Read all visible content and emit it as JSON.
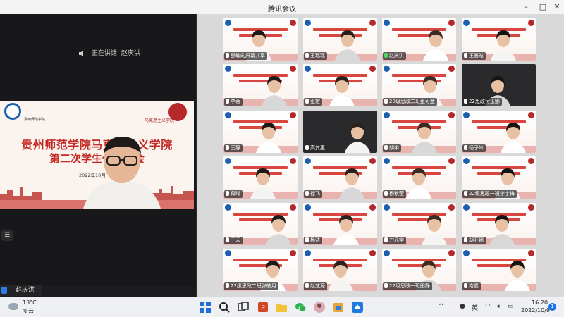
{
  "window": {
    "title": "腾讯会议"
  },
  "speaker": {
    "label": "正在讲话: 赵庆洪"
  },
  "main_video": {
    "school_left": "贵州师范学院",
    "school_right": "马克思主义学院",
    "banner_line1": "贵州师范学院马克思主义学院",
    "banner_line2": "第二次学生代表大会",
    "date": "2022年10月"
  },
  "self_view": {
    "name": "赵庆洪"
  },
  "participants": [
    {
      "name": "舒敏的屏幕共享",
      "mic": "off"
    },
    {
      "name": "王瑶瑶",
      "mic": "off"
    },
    {
      "name": "赵庆洪",
      "mic": "on"
    },
    {
      "name": "王雅晗",
      "mic": "off"
    },
    {
      "name": "李蓉",
      "mic": "off"
    },
    {
      "name": "张宏",
      "mic": "off"
    },
    {
      "name": "20级思政二班张可慧",
      "mic": "off"
    },
    {
      "name": "22思政付玉娜",
      "mic": "off"
    },
    {
      "name": "王静",
      "mic": "off"
    },
    {
      "name": "高其惠",
      "mic": "off"
    },
    {
      "name": "胡中",
      "mic": "off"
    },
    {
      "name": "杨子岭",
      "mic": "off"
    },
    {
      "name": "段晰",
      "mic": "off"
    },
    {
      "name": "徐飞",
      "mic": "off"
    },
    {
      "name": "杨秋莹",
      "mic": "off"
    },
    {
      "name": "22级思政一班李宇梅",
      "mic": "off"
    },
    {
      "name": "王云",
      "mic": "off"
    },
    {
      "name": "杨洁",
      "mic": "off"
    },
    {
      "name": "刀凡宇",
      "mic": "off"
    },
    {
      "name": "胡亚娜",
      "mic": "off"
    },
    {
      "name": "22级思政二班张敏月",
      "mic": "off"
    },
    {
      "name": "赵芝源",
      "mic": "off"
    },
    {
      "name": "22级思政一班田静",
      "mic": "off"
    },
    {
      "name": "南嘉",
      "mic": "off"
    }
  ],
  "taskbar": {
    "temperature": "13°C",
    "condition": "多云",
    "input_method": "英",
    "time": "16:20",
    "date": "2022/10/9",
    "notifications": "1"
  },
  "colors": {
    "banner_red": "#c42a25",
    "school_blue": "#1b5fb0",
    "mic_active": "#4cd964",
    "accent": "#2a7de1"
  }
}
